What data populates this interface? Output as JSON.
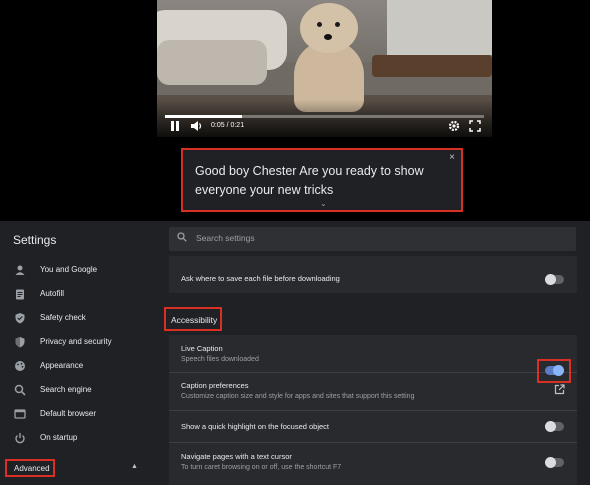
{
  "video": {
    "time_label": "0:05 / 0:21",
    "progress": 0.24,
    "icons": [
      "pause-icon",
      "volume-icon",
      "gear-icon",
      "fullscreen-icon"
    ]
  },
  "caption": {
    "text": "Good boy Chester Are you ready to show everyone your new tricks",
    "close_glyph": "×",
    "expand_glyph": "⌄"
  },
  "settings": {
    "title": "Settings",
    "search_placeholder": "Search settings",
    "sidebar": {
      "items": [
        {
          "label": "You and Google",
          "icon": "person-icon"
        },
        {
          "label": "Autofill",
          "icon": "clipboard-icon"
        },
        {
          "label": "Safety check",
          "icon": "shield-check-icon"
        },
        {
          "label": "Privacy and security",
          "icon": "shield-icon"
        },
        {
          "label": "Appearance",
          "icon": "palette-icon"
        },
        {
          "label": "Search engine",
          "icon": "search-icon"
        },
        {
          "label": "Default browser",
          "icon": "browser-icon"
        },
        {
          "label": "On startup",
          "icon": "power-icon"
        }
      ],
      "advanced_label": "Advanced",
      "advanced_glyph": "▲"
    },
    "downloads_row": {
      "title": "Ask where to save each file before downloading",
      "enabled": false
    },
    "accessibility_header": "Accessibility",
    "rows": [
      {
        "title": "Live Caption",
        "subtitle": "Speech files downloaded",
        "control": "toggle",
        "enabled": true
      },
      {
        "title": "Caption preferences",
        "subtitle": "Customize caption size and style for apps and sites that support this setting",
        "control": "external-link"
      },
      {
        "title": "Show a quick highlight on the focused object",
        "subtitle": "",
        "control": "toggle",
        "enabled": false
      },
      {
        "title": "Navigate pages with a text cursor",
        "subtitle": "To turn caret browsing on or off, use the shortcut F7",
        "control": "toggle",
        "enabled": false
      }
    ]
  },
  "colors": {
    "accent_toggle": "#8ab4f8",
    "highlight_border": "#d93025",
    "background": "#202124",
    "card": "#292a2d"
  }
}
